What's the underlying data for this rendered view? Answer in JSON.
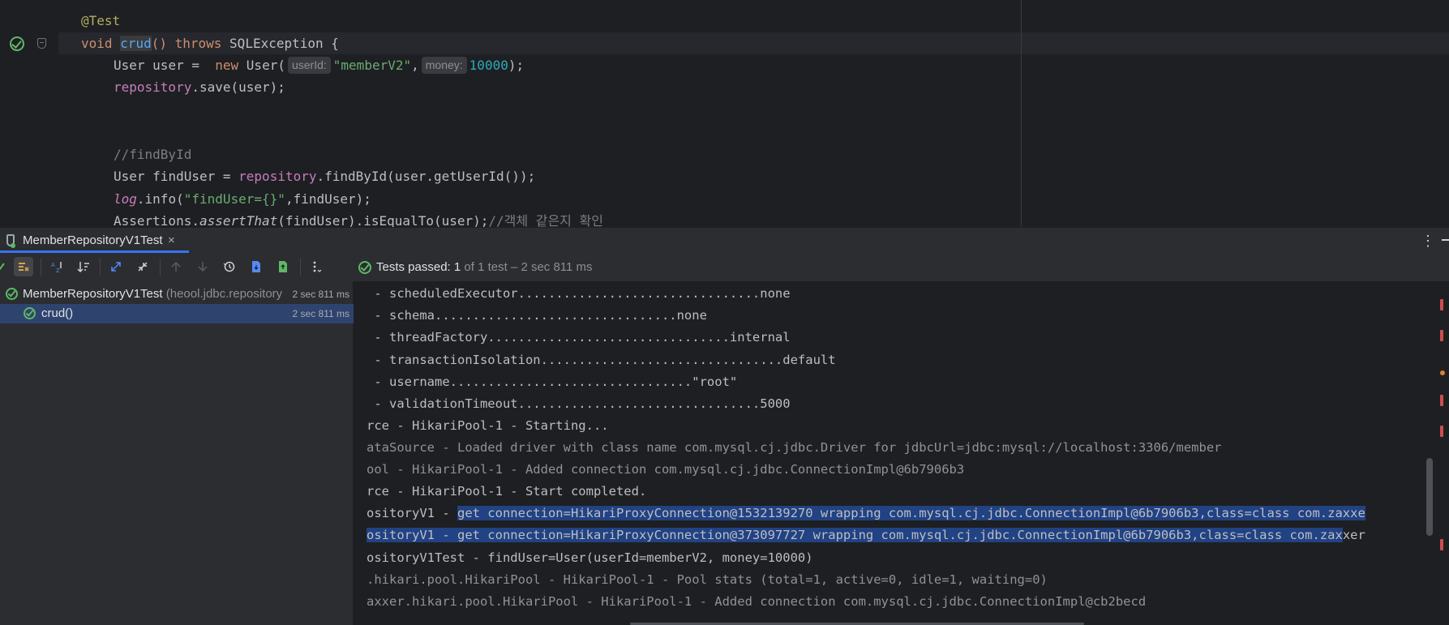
{
  "editor": {
    "line_numbers": [
      "",
      "",
      "",
      "",
      "",
      "",
      "",
      "",
      "",
      ""
    ],
    "lines": {
      "annotation": "@Test",
      "signature": {
        "kw_void": "void",
        "name": "crud",
        "parens": "()",
        "kw_throws": "throws",
        "exception": "SQLException",
        "brace": "{"
      },
      "user_decl": {
        "type": "User",
        "var": "user",
        "eq": "=",
        "kw_new": "new",
        "ctor": "User(",
        "hint_userid": "userId:",
        "arg1": "\"memberV2\"",
        "comma": ",",
        "hint_money": "money:",
        "arg2": "10000",
        "end": ");"
      },
      "save": {
        "field": "repository",
        "call": ".save(user);"
      },
      "comment_find": "//findById",
      "find": {
        "type": "User",
        "var": "findUser",
        "eq": "=",
        "field": "repository",
        "call": ".findById(user.getUserId());"
      },
      "log": {
        "field": "log",
        "call": ".info(",
        "str": "\"findUser={}\"",
        "rest": ",findUser);"
      },
      "assert": {
        "cls": "Assertions.",
        "method": "assertThat",
        "rest": "(findUser).isEqualTo(user);",
        "comment": "//객체 같은지 확인"
      }
    }
  },
  "tool_window": {
    "tab_label": "MemberRepositoryV1Test",
    "tab_close": "×",
    "menu_icon": "⋮"
  },
  "toolbar": {
    "status_prefix": "Tests passed: ",
    "status_count": "1",
    "status_detail": " of 1 test – 2 sec 811 ms"
  },
  "tree": {
    "root": {
      "label": "MemberRepositoryV1Test",
      "package": " (heool.jdbc.repository",
      "time": "2 sec 811 ms"
    },
    "child": {
      "label": "crud()",
      "time": "2 sec 811 ms"
    }
  },
  "console": {
    "lines": [
      {
        "text": " - scheduledExecutor................................none",
        "dim": false
      },
      {
        "text": " - schema................................none",
        "dim": false
      },
      {
        "text": " - threadFactory................................internal",
        "dim": false
      },
      {
        "text": " - transactionIsolation................................default",
        "dim": false
      },
      {
        "text": " - username................................\"root\"",
        "dim": false
      },
      {
        "text": " - validationTimeout................................5000",
        "dim": false
      },
      {
        "text": "rce - HikariPool-1 - Starting...",
        "dim": false
      },
      {
        "text": "ataSource - Loaded driver with class name com.mysql.cj.jdbc.Driver for jdbcUrl=jdbc:mysql://localhost:3306/member",
        "dim": true
      },
      {
        "text": "ool - HikariPool-1 - Added connection com.mysql.cj.jdbc.ConnectionImpl@6b7906b3",
        "dim": true
      },
      {
        "text": "rce - HikariPool-1 - Start completed.",
        "dim": false
      },
      {
        "text_prefix": "ositoryV1 - ",
        "text_sel": "get connection=HikariProxyConnection@1532139270 wrapping com.mysql.cj.jdbc.ConnectionImpl@6b7906b3,class=class com.zaxxe"
      },
      {
        "text_sel": "ositoryV1 - get connection=HikariProxyConnection@373097727 wrapping com.mysql.cj.jdbc.ConnectionImpl@6b7906b3,class=class com.zax",
        "text_after": "xer"
      },
      {
        "text": "ositoryV1Test - findUser=User(userId=memberV2, money=10000)",
        "dim": false
      },
      {
        "text": ".hikari.pool.HikariPool - HikariPool-1 - Pool stats (total=1, active=0, idle=1, waiting=0)",
        "dim": true
      },
      {
        "text": "axxer.hikari.pool.HikariPool - HikariPool-1 - Added connection com.mysql.cj.jdbc.ConnectionImpl@cb2becd",
        "dim": true
      }
    ]
  },
  "icons": {
    "run_test": "run-test-passed-icon",
    "fold": "fold-icon",
    "test_tab": "test-tab-icon"
  },
  "colors": {
    "keyword": "#cf8e6d",
    "annotation": "#b3ae60",
    "method": "#56a8f5",
    "field": "#c77dbb",
    "string": "#6aab73",
    "number": "#2aacb8",
    "comment": "#7a7e85",
    "passed": "#5fb865",
    "selection": "#214283",
    "tree_selection": "#2e436e",
    "accent": "#3574f0"
  }
}
